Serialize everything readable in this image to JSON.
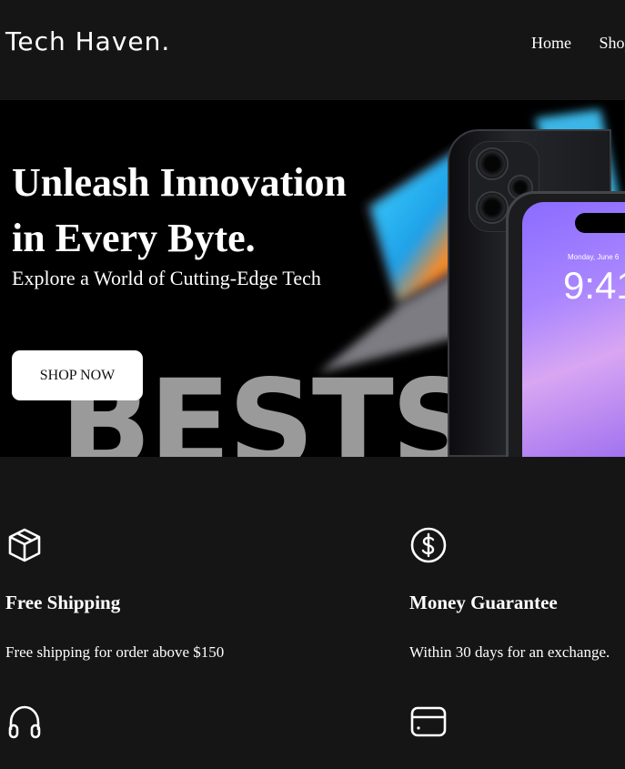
{
  "header": {
    "logo": "Tech Haven.",
    "nav": [
      "Home",
      "Shop"
    ]
  },
  "hero": {
    "title_line1": "Unleash Innovation",
    "title_line2": "in Every Byte.",
    "subtitle": "Explore a World of Cutting-Edge Tech",
    "cta_label": "SHOP NOW",
    "background_text": "BESTS",
    "phone_date": "Monday, June 6",
    "phone_time": "9:41"
  },
  "features": [
    {
      "icon": "box-icon",
      "title": "Free Shipping",
      "desc": "Free shipping for order above $150"
    },
    {
      "icon": "dollar-icon",
      "title": "Money Guarantee",
      "desc": "Within 30 days for an exchange."
    },
    {
      "icon": "headphones-icon",
      "title": "",
      "desc": ""
    },
    {
      "icon": "card-icon",
      "title": "",
      "desc": ""
    }
  ],
  "colors": {
    "background": "#151515",
    "hero_bg": "#000000",
    "accent_text": "#ffffff",
    "button_bg": "#ffffff"
  }
}
